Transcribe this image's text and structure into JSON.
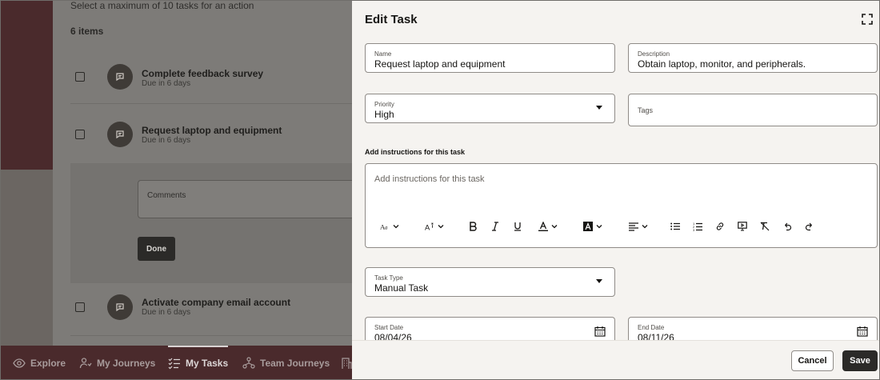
{
  "background": {
    "limit_note": "Select a maximum of 10 tasks for an action",
    "item_count": "6 items",
    "tasks": [
      {
        "title": "Complete feedback survey",
        "due": "Due in 6 days"
      },
      {
        "title": "Request laptop and equipment",
        "due": "Due in 6 days"
      },
      {
        "title": "Activate company email account",
        "due": "Due in 6 days"
      }
    ],
    "comments_label": "Comments",
    "done_label": "Done",
    "nav": [
      {
        "label": "Explore",
        "icon": "eye-icon"
      },
      {
        "label": "My Journeys",
        "icon": "person-route-icon"
      },
      {
        "label": "My Tasks",
        "icon": "checklist-icon",
        "active": true
      },
      {
        "label": "Team Journeys",
        "icon": "team-icon"
      }
    ]
  },
  "drawer": {
    "title": "Edit Task",
    "name": {
      "label": "Name",
      "value": "Request laptop and equipment"
    },
    "description": {
      "label": "Description",
      "value": "Obtain laptop, monitor, and peripherals."
    },
    "priority": {
      "label": "Priority",
      "value": "High"
    },
    "tags": {
      "label": "Tags"
    },
    "instructions_label": "Add instructions for this task",
    "instructions_placeholder": "Add instructions for this task",
    "task_type": {
      "label": "Task Type",
      "value": "Manual Task"
    },
    "start_date": {
      "label": "Start Date",
      "value": "08/04/26"
    },
    "end_date": {
      "label": "End Date",
      "value": "08/11/26"
    },
    "cancel_label": "Cancel",
    "save_label": "Save"
  },
  "colors": {
    "brand_dark": "#4a2a2c",
    "primary_button": "#2b2a28",
    "drawer_bg": "#f5f3f0"
  }
}
